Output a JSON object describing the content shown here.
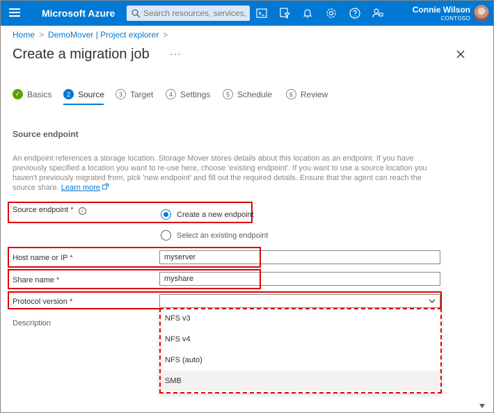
{
  "topbar": {
    "brand": "Microsoft Azure",
    "search_placeholder": "Search resources, services, and docs (G+/)",
    "user_name": "Connie Wilson",
    "user_org": "CONTOSO",
    "icons": [
      "cloud-shell-icon",
      "directory-filter-icon",
      "notifications-icon",
      "settings-icon",
      "help-icon",
      "feedback-icon"
    ],
    "accent": "#0078d4"
  },
  "breadcrumb": [
    "Home",
    "DemoMover | Project explorer"
  ],
  "page": {
    "title": "Create a migration job",
    "more_label": "···"
  },
  "steps": [
    {
      "num": "✓",
      "label": "Basics",
      "state": "done"
    },
    {
      "num": "2",
      "label": "Source",
      "state": "active"
    },
    {
      "num": "3",
      "label": "Target",
      "state": "todo"
    },
    {
      "num": "4",
      "label": "Settings",
      "state": "todo"
    },
    {
      "num": "5",
      "label": "Schedule",
      "state": "todo"
    },
    {
      "num": "6",
      "label": "Review",
      "state": "todo"
    }
  ],
  "section": {
    "title": "Source endpoint",
    "description": "An endpoint references a storage location. Storage Mover stores details about this location as an endpoint. If you have previously specified a location you want to re-use here, choose 'existing endpoint'. If you want to use a source location you haven't previously migrated from, pick 'new endpoint' and fill out the required details. Ensure that the agent can reach the source share.",
    "learn_more": "Learn more"
  },
  "form": {
    "source_endpoint_label": "Source endpoint",
    "radio_new": "Create a new endpoint",
    "radio_existing": "Select an existing endpoint",
    "host_label": "Host name or IP",
    "host_value": "myserver",
    "share_label": "Share name",
    "share_value": "myshare",
    "protocol_label": "Protocol version",
    "protocol_value": "",
    "description_label": "Description",
    "required_mark": "*"
  },
  "dropdown": {
    "options": [
      "NFS v3",
      "NFS v4",
      "NFS (auto)",
      "SMB"
    ],
    "hovered": "SMB"
  },
  "highlight_color": "#e00000"
}
